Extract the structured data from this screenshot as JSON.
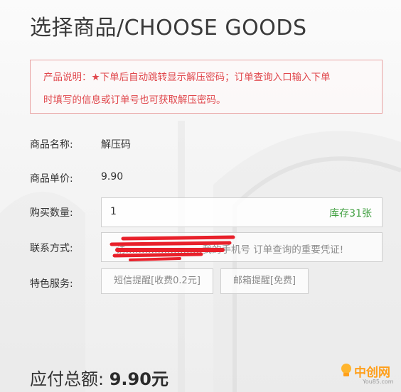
{
  "page": {
    "title": "选择商品/CHOOSE GOODS",
    "notice_line1": "产品说明：★下单后自动跳转显示解压密码；订单查询入口输入下单",
    "notice_line2": "时填写的信息或订单号也可获取解压密码。"
  },
  "form": {
    "name_label": "商品名称:",
    "name_value": "解压码",
    "price_label": "商品单价:",
    "price_value": "9.90",
    "qty_label": "购买数量:",
    "qty_value": "1",
    "stock_text": "库存31张",
    "contact_label": "联系方式:",
    "contact_placeholder": "请……………………我的手机号 订单查询的重要凭证!",
    "service_label": "特色服务:",
    "sms_button": "短信提醒[收费0.2元]",
    "email_button": "邮箱提醒[免费]"
  },
  "total": {
    "label": "应付总额:",
    "amount": "9.90元"
  },
  "watermark": {
    "text": "中创网",
    "sub": "You85.com"
  },
  "colors": {
    "accent_red": "#e0474c",
    "stock_green": "#3f9f3f",
    "redaction_red": "#e8202a"
  }
}
